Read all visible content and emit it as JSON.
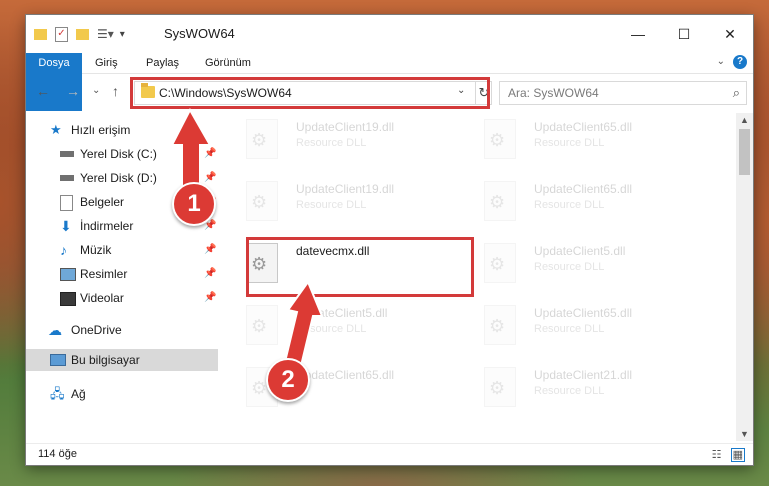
{
  "window": {
    "title": "SysWOW64",
    "controls": {
      "minimize": "—",
      "maximize": "☐",
      "close": "✕"
    }
  },
  "ribbon": {
    "tabs": [
      "Dosya",
      "Giriş",
      "Paylaş",
      "Görünüm"
    ],
    "help": "?"
  },
  "address": {
    "path": "C:\\Windows\\SysWOW64",
    "search_placeholder": "Ara: SysWOW64"
  },
  "nav": {
    "items": [
      {
        "label": "Hızlı erişim",
        "icon": "star-icon"
      },
      {
        "label": "Yerel Disk (C:)",
        "icon": "drive-icon"
      },
      {
        "label": "Yerel Disk (D:)",
        "icon": "drive-icon"
      },
      {
        "label": "Belgeler",
        "icon": "documents-icon"
      },
      {
        "label": "İndirmeler",
        "icon": "download-icon"
      },
      {
        "label": "Müzik",
        "icon": "music-icon"
      },
      {
        "label": "Resimler",
        "icon": "pictures-icon"
      },
      {
        "label": "Videolar",
        "icon": "video-icon"
      },
      {
        "label": "OneDrive",
        "icon": "cloud-icon"
      },
      {
        "label": "Bu bilgisayar",
        "icon": "computer-icon"
      },
      {
        "label": "Ağ",
        "icon": "network-icon"
      }
    ]
  },
  "files": [
    {
      "name": "UpdateClient19.dll",
      "type": "Resource DLL"
    },
    {
      "name": "UpdateClient65.dll",
      "type": "Resource DLL"
    },
    {
      "name": "UpdateClient19.dll",
      "type": "Resource DLL"
    },
    {
      "name": "UpdateClient65.dll",
      "type": "Resource DLL"
    },
    {
      "name": "datevecmx.dll",
      "type": ""
    },
    {
      "name": "UpdateClient5.dll",
      "type": "Resource DLL"
    },
    {
      "name": "UpdateClient5.dll",
      "type": "Resource DLL"
    },
    {
      "name": "UpdateClient65.dll",
      "type": "Resource DLL"
    },
    {
      "name": "UpdateClient65.dll",
      "type": ""
    },
    {
      "name": "UpdateClient21.dll",
      "type": "Resource DLL"
    }
  ],
  "status": {
    "count": "114 öğe"
  },
  "callouts": {
    "one": "1",
    "two": "2"
  },
  "colors": {
    "accent": "#1979ca",
    "highlight": "#d33a3a"
  }
}
